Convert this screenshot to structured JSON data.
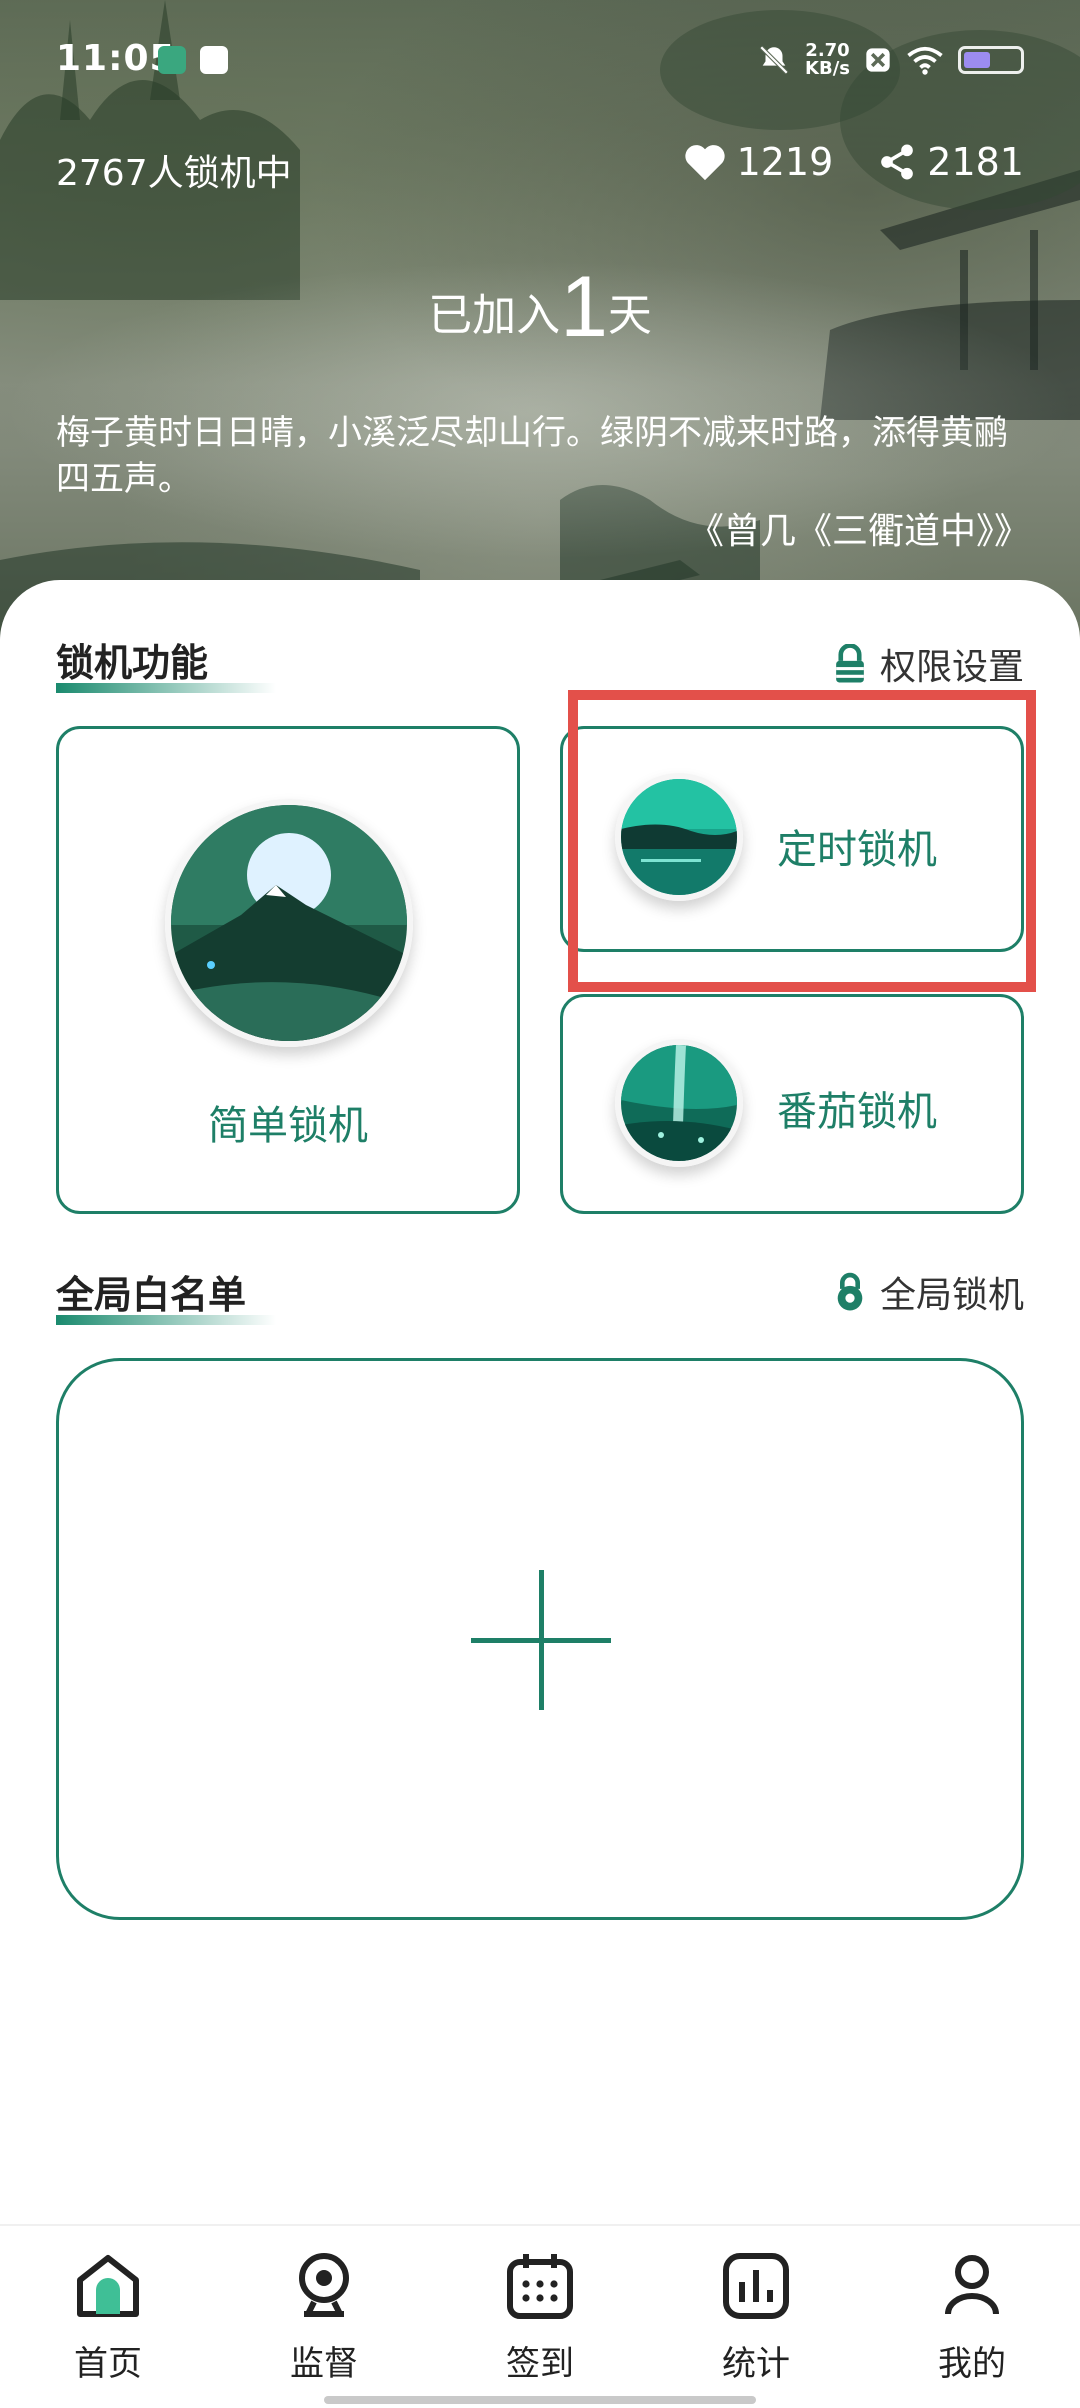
{
  "status": {
    "time": "11:05",
    "net_speed_top": "2.70",
    "net_speed_bottom": "KB/s"
  },
  "header": {
    "online_text": "2767人锁机中",
    "likes": "1219",
    "shares": "2181",
    "joined_prefix": "已加入",
    "joined_days": "1",
    "joined_suffix": "天",
    "poem": "梅子黄时日日晴，小溪泛尽却山行。绿阴不减来时路，添得黄鹂四五声。",
    "poem_source": "《曾几《三衢道中》》"
  },
  "lock_section": {
    "title": "锁机功能",
    "permission_link": "权限设置",
    "cards": [
      {
        "label": "简单锁机",
        "icon": "mountain-moon-image"
      },
      {
        "label": "定时锁机",
        "icon": "lake-image"
      },
      {
        "label": "番茄锁机",
        "icon": "waterfall-image"
      }
    ]
  },
  "whitelist_section": {
    "title": "全局白名单",
    "global_lock_link": "全局锁机"
  },
  "tabs": [
    {
      "label": "首页",
      "icon": "home-icon"
    },
    {
      "label": "监督",
      "icon": "webcam-icon"
    },
    {
      "label": "签到",
      "icon": "calendar-icon"
    },
    {
      "label": "统计",
      "icon": "chart-icon"
    },
    {
      "label": "我的",
      "icon": "user-icon"
    }
  ],
  "colors": {
    "accent": "#1e7f67",
    "highlight": "#e3504a"
  }
}
